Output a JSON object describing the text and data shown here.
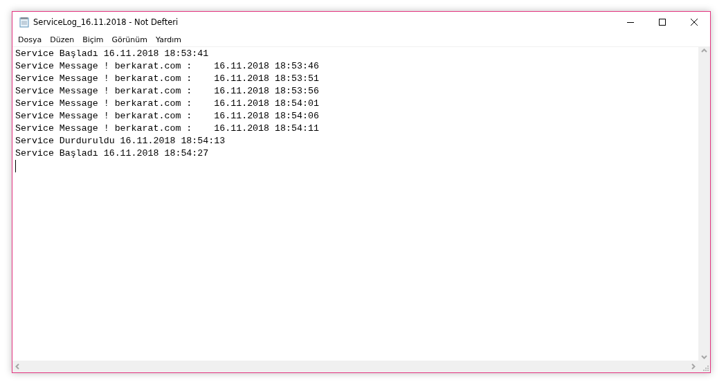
{
  "window": {
    "title": "ServiceLog_16.11.2018 - Not Defteri"
  },
  "menu": [
    "Dosya",
    "Düzen",
    "Biçim",
    "Görünüm",
    "Yardım"
  ],
  "editor": {
    "lines": [
      "Service Başladı 16.11.2018 18:53:41",
      "Service Message ! berkarat.com :    16.11.2018 18:53:46",
      "Service Message ! berkarat.com :    16.11.2018 18:53:51",
      "Service Message ! berkarat.com :    16.11.2018 18:53:56",
      "Service Message ! berkarat.com :    16.11.2018 18:54:01",
      "Service Message ! berkarat.com :    16.11.2018 18:54:06",
      "Service Message ! berkarat.com :    16.11.2018 18:54:11",
      "Service Durduruldu 16.11.2018 18:54:13",
      "Service Başladı 16.11.2018 18:54:27"
    ]
  }
}
